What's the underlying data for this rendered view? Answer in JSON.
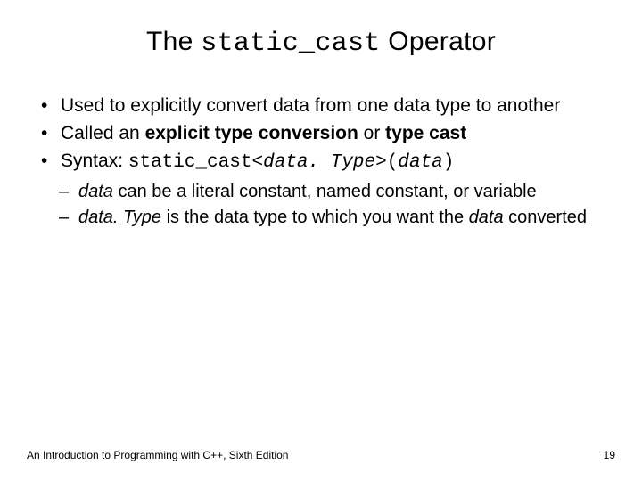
{
  "title": {
    "pre": "The ",
    "code": "static_cast",
    "post": " Operator"
  },
  "bullets": {
    "b1": "Used to explicitly convert data from one data type to another",
    "b2": {
      "pre": "Called an ",
      "bold1": "explicit type conversion",
      "mid": " or ",
      "bold2": "type cast"
    },
    "b3": {
      "pre": "Syntax: ",
      "code1": "static_cast<",
      "ital1": "data. Type",
      "code2": ">(",
      "ital2": "data",
      "code3": ")"
    }
  },
  "sub": {
    "s1": {
      "ital": "data",
      "rest": " can be a literal constant, named constant, or variable"
    },
    "s2": {
      "ital1": "data. Type",
      "mid": " is the data type to which you want the ",
      "ital2": "data",
      "rest": " converted"
    }
  },
  "footer": {
    "left": "An Introduction to Programming with C++, Sixth Edition",
    "right": "19"
  }
}
